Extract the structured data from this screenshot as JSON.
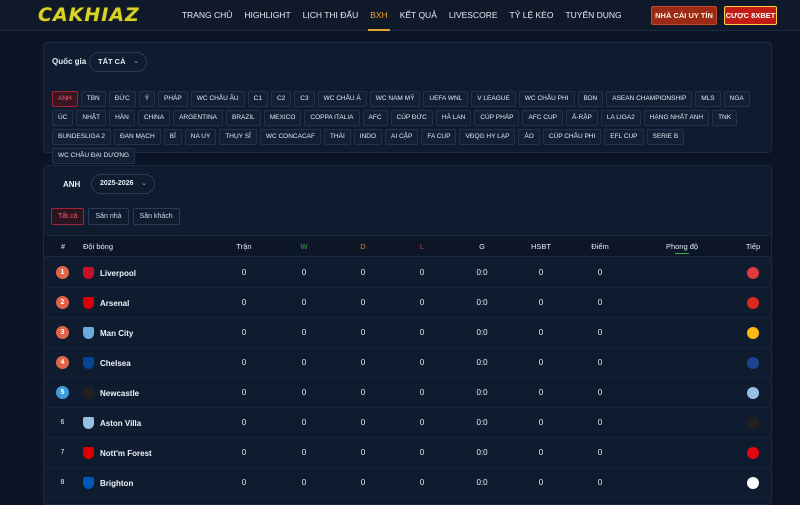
{
  "brand": {
    "logo": "CAKHIAZ"
  },
  "nav": {
    "items": [
      "TRANG CHỦ",
      "HIGHLIGHT",
      "LỊCH THI ĐẤU",
      "BXH",
      "KẾT QUẢ",
      "LIVESCORE",
      "TỶ LỆ KÈO",
      "TUYỂN DỤNG"
    ],
    "active_index": 3
  },
  "top_buttons": {
    "trusted": "NHÀ CÁI UY TÍN",
    "bet": "CƯỢC 8XBET"
  },
  "country_filter": {
    "label": "Quốc gia",
    "selected": "TẤT CẢ"
  },
  "leagues": [
    "ANH",
    "TBN",
    "ĐỨC",
    "Ý",
    "PHÁP",
    "WC CHÂU ÂU",
    "C1",
    "C2",
    "C3",
    "WC CHÂU Á",
    "WC NAM MỸ",
    "UEFA WNL",
    "V LEAGUE",
    "WC CHÂU PHI",
    "BDN",
    "ASEAN CHAMPIONSHIP",
    "MLS",
    "NGA",
    "ÚC",
    "NHẬT",
    "HÀN",
    "CHINA",
    "ARGENTINA",
    "BRAZIL",
    "MEXICO",
    "COPPA ITALIA",
    "AFC",
    "CÚP ĐỨC",
    "HÀ LAN",
    "CÚP PHÁP",
    "AFC CUP",
    "Ả-RẬP",
    "LA LIGA2",
    "HẠNG NHẤT ANH",
    "TNK",
    "BUNDESLIGA 2",
    "ĐAN MẠCH",
    "BỈ",
    "NA UY",
    "THỤY SĨ",
    "WC CONCACAF",
    "THÁI",
    "INDO",
    "AI CẬP",
    "FA CUP",
    "VĐQG HY LẠP",
    "ÁO",
    "CÚP CHÂU PHI",
    "EFL CUP",
    "SERIE B",
    "WC CHÂU ĐẠI DƯƠNG"
  ],
  "active_league_index": 0,
  "standings": {
    "league": "ANH",
    "season": "2025-2026",
    "tabs": [
      "Tất cả",
      "Sân nhà",
      "Sân khách"
    ],
    "active_tab_index": 0,
    "columns": {
      "rank": "#",
      "team": "Đội bóng",
      "played": "Trận",
      "w": "W",
      "d": "D",
      "l": "L",
      "goals": "G",
      "gd": "HSBT",
      "points": "Điểm",
      "form": "Phong độ",
      "next": "Tiếp"
    },
    "rows": [
      {
        "rank": "1",
        "team": "Liverpool",
        "played": "0",
        "w": "0",
        "d": "0",
        "l": "0",
        "goals": "0:0",
        "gd": "0",
        "points": "0",
        "zone": "cl",
        "crest_color": "#c8102e",
        "next_color": "#e03a3e"
      },
      {
        "rank": "2",
        "team": "Arsenal",
        "played": "0",
        "w": "0",
        "d": "0",
        "l": "0",
        "goals": "0:0",
        "gd": "0",
        "points": "0",
        "zone": "cl",
        "crest_color": "#db0007",
        "next_color": "#da291c"
      },
      {
        "rank": "3",
        "team": "Man City",
        "played": "0",
        "w": "0",
        "d": "0",
        "l": "0",
        "goals": "0:0",
        "gd": "0",
        "points": "0",
        "zone": "cl",
        "crest_color": "#6cabdd",
        "next_color": "#fdb913"
      },
      {
        "rank": "4",
        "team": "Chelsea",
        "played": "0",
        "w": "0",
        "d": "0",
        "l": "0",
        "goals": "0:0",
        "gd": "0",
        "points": "0",
        "zone": "cl",
        "crest_color": "#034694",
        "next_color": "#1b458f"
      },
      {
        "rank": "5",
        "team": "Newcastle",
        "played": "0",
        "w": "0",
        "d": "0",
        "l": "0",
        "goals": "0:0",
        "gd": "0",
        "points": "0",
        "zone": "el",
        "crest_color": "#241f20",
        "next_color": "#95bfe5"
      },
      {
        "rank": "6",
        "team": "Aston Villa",
        "played": "0",
        "w": "0",
        "d": "0",
        "l": "0",
        "goals": "0:0",
        "gd": "0",
        "points": "0",
        "zone": "plain",
        "crest_color": "#95bfe5",
        "next_color": "#241f20"
      },
      {
        "rank": "7",
        "team": "Nott'm Forest",
        "played": "0",
        "w": "0",
        "d": "0",
        "l": "0",
        "goals": "0:0",
        "gd": "0",
        "points": "0",
        "zone": "plain",
        "crest_color": "#dd0000",
        "next_color": "#e30613"
      },
      {
        "rank": "8",
        "team": "Brighton",
        "played": "0",
        "w": "0",
        "d": "0",
        "l": "0",
        "goals": "0:0",
        "gd": "0",
        "points": "0",
        "zone": "plain",
        "crest_color": "#0057b8",
        "next_color": "#ffffff"
      }
    ]
  }
}
